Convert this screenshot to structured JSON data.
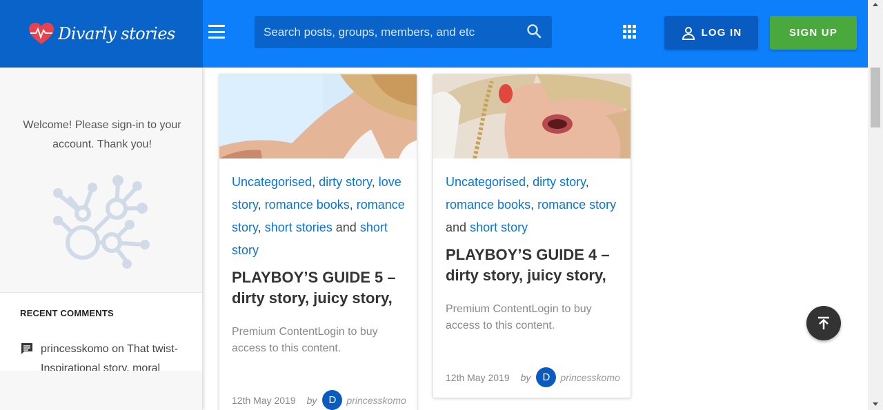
{
  "header": {
    "logo_text": "Divarly stories",
    "search_placeholder": "Search posts, groups, members, and etc",
    "login_label": "LOG IN",
    "signup_label": "SIGN UP"
  },
  "sidebar": {
    "welcome": "Welcome! Please sign-in to your account. Thank you!",
    "recent_title": "RECENT COMMENTS",
    "comment": {
      "author": "princesskomo",
      "on": "on",
      "text": "That twist- Inspirational story, moral"
    }
  },
  "posts": [
    {
      "cats": [
        "Uncategorised",
        "dirty story",
        "love story",
        "romance books",
        "romance story",
        "short stories"
      ],
      "last_cat": "short story",
      "title": "PLAYBOY’S GUIDE 5 – dirty story, juicy story,",
      "excerpt": "Premium ContentLogin to buy access to this content.",
      "date": "12th May 2019",
      "by": "by",
      "avatar_letter": "D",
      "author": "princesskomo"
    },
    {
      "cats": [
        "Uncategorised",
        "dirty story",
        "romance books",
        "romance story"
      ],
      "last_cat": "short story",
      "title": "PLAYBOY’S GUIDE 4 – dirty story, juicy story,",
      "excerpt": "Premium ContentLogin to buy access to this content.",
      "date": "12th May 2019",
      "by": "by",
      "avatar_letter": "D",
      "author": "princesskomo"
    }
  ],
  "joiner": "and",
  "icons": [
    "menu-icon",
    "search-icon",
    "apps-grid-icon",
    "user-icon",
    "network-icon",
    "comment-icon",
    "back-to-top-icon"
  ],
  "colors": {
    "header": "#0d7ffb",
    "logo_bg": "#0a63c9",
    "signup": "#4aa93c",
    "link": "#0a73d6"
  }
}
